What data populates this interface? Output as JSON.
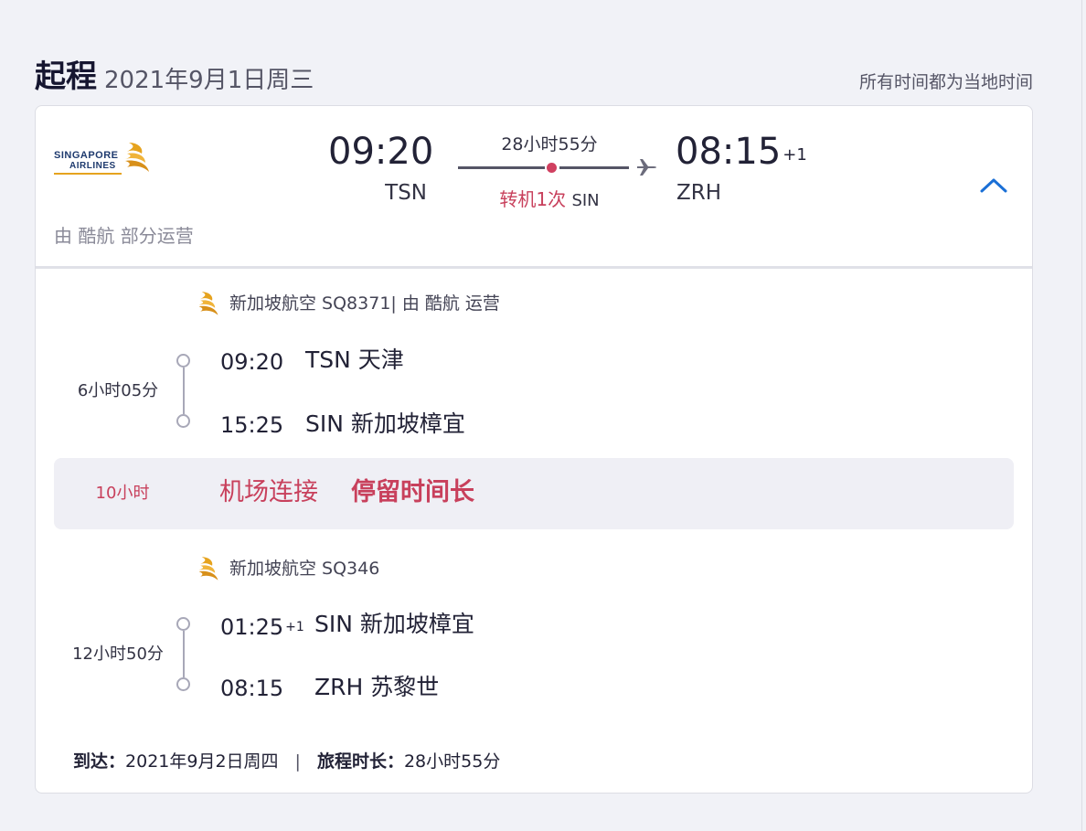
{
  "header": {
    "title": "起程",
    "date": "2021年9月1日周三",
    "note": "所有时间都为当地时间"
  },
  "summary": {
    "airline_logo_line1": "SINGAPORE",
    "airline_logo_line2": "AIRLINES",
    "dep_time": "09:20",
    "dep_code": "TSN",
    "duration": "28小时55分",
    "stops_count": "转机1次",
    "stops_code": "SIN",
    "arr_time": "08:15",
    "arr_day_offset": "+1",
    "arr_code": "ZRH",
    "operated_by": "由 酷航 部分运营"
  },
  "segments": [
    {
      "airline": "新加坡航空 SQ8371| 由 酷航 运营",
      "duration": "6小时05分",
      "dep_time": "09:20",
      "dep_place": "TSN 天津",
      "arr_time": "15:25",
      "arr_place": "SIN 新加坡樟宜"
    },
    {
      "airline": "新加坡航空 SQ346",
      "duration": "12小时50分",
      "dep_time": "01:25",
      "dep_day_offset": "+1",
      "dep_place": "SIN 新加坡樟宜",
      "arr_time": "08:15",
      "arr_place": "ZRH 苏黎世"
    }
  ],
  "layover": {
    "duration": "10小时",
    "connection": "机场连接",
    "long_stop": "停留时间长"
  },
  "footer": {
    "arrive_label": "到达：",
    "arrive_date": "2021年9月2日周四",
    "separator": "|",
    "total_label": "旅程时长：",
    "total_duration": "28小时55分"
  },
  "colors": {
    "accent_red": "#c8405c",
    "chevron_blue": "#1a6fd6",
    "logo_gold": "#e6a31e"
  },
  "icons": [
    "singapore-airlines-bird-icon",
    "plane-icon",
    "chevron-up-icon",
    "timeline-circle-icon"
  ]
}
